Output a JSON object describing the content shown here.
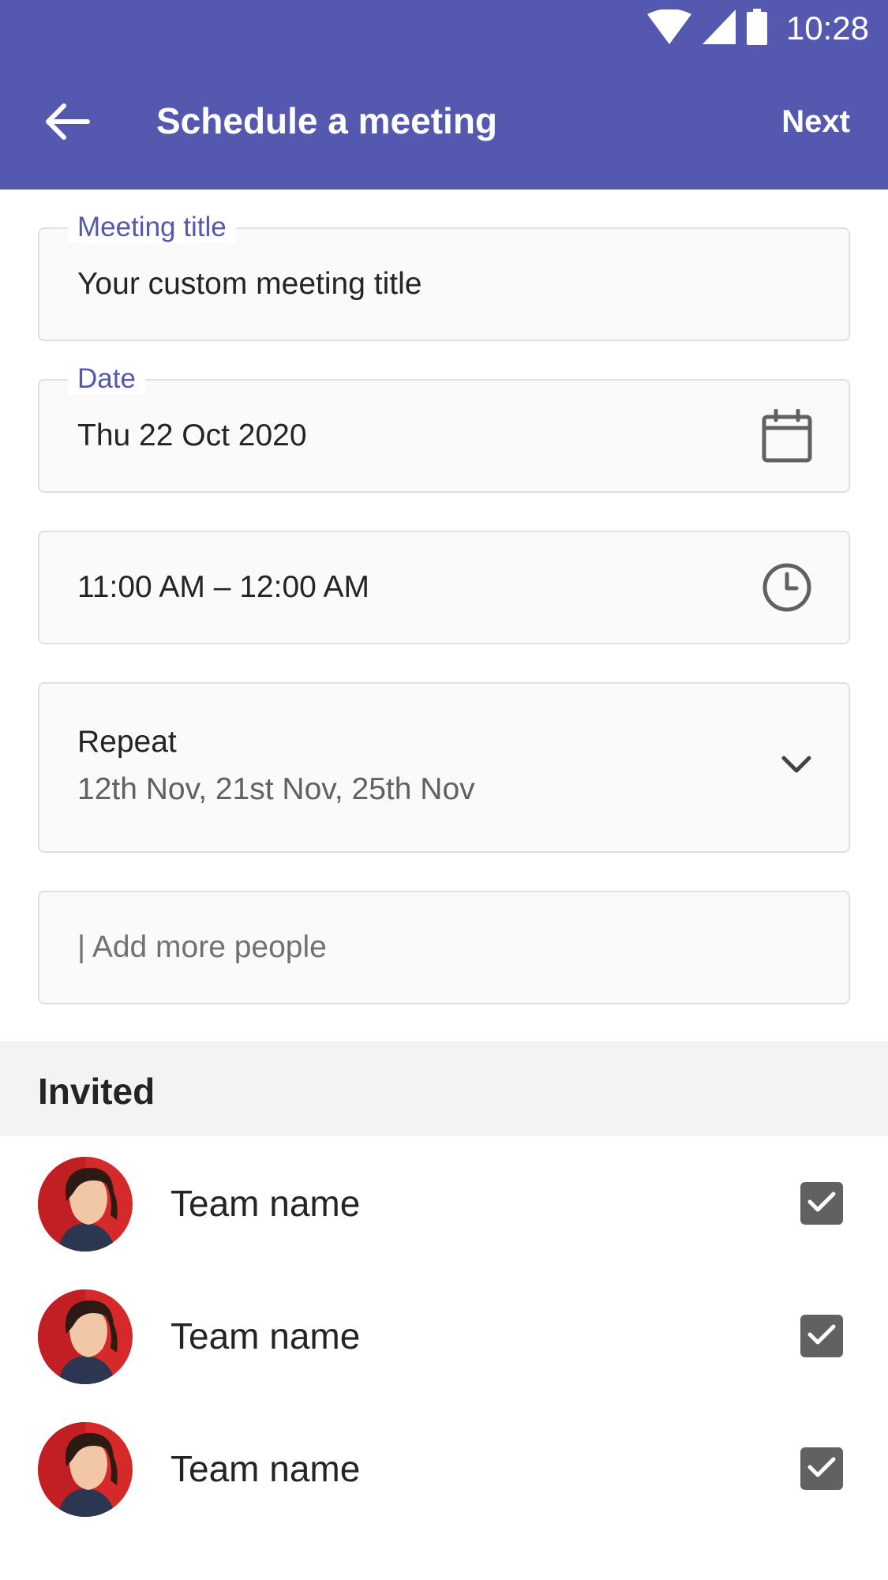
{
  "status_bar": {
    "time": "10:28",
    "icons": [
      "wifi-icon",
      "cellular-signal-icon",
      "battery-icon"
    ]
  },
  "toolbar": {
    "back_icon": "arrow-left-icon",
    "title": "Schedule a meeting",
    "next_label": "Next"
  },
  "form": {
    "meeting_title": {
      "label": "Meeting title",
      "value": "Your custom meeting title"
    },
    "date": {
      "label": "Date",
      "value": "Thu 22 Oct 2020",
      "icon": "calendar-icon"
    },
    "time": {
      "value": "11:00 AM – 12:00 AM",
      "icon": "clock-icon"
    },
    "repeat": {
      "label": "Repeat",
      "value": "12th Nov, 21st Nov, 25th Nov",
      "icon": "chevron-down-icon"
    },
    "people": {
      "placeholder": "| Add more people"
    }
  },
  "invited": {
    "title": "Invited",
    "items": [
      {
        "name": "Team name",
        "checked": true
      },
      {
        "name": "Team name",
        "checked": true
      },
      {
        "name": "Team name",
        "checked": true
      }
    ]
  },
  "colors": {
    "brand": "#5558af",
    "field_border": "#e1e1e1",
    "section_bg": "#f3f3f3",
    "checkbox": "#616161"
  }
}
